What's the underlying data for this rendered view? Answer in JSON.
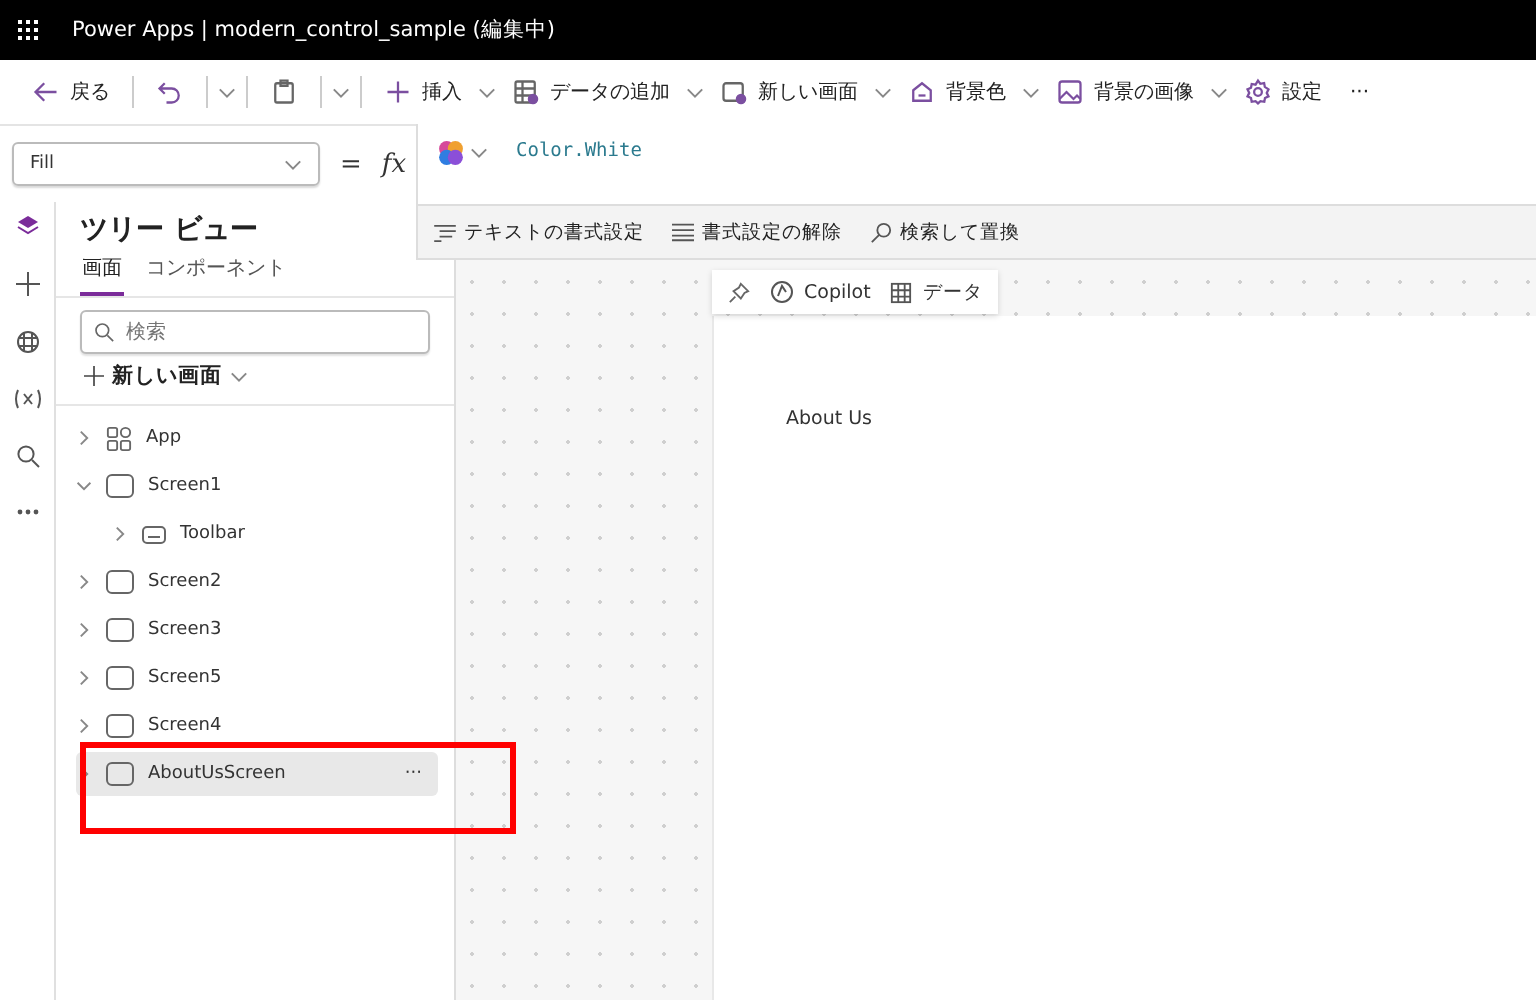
{
  "window": {
    "title": "Power Apps | modern_control_sample (編集中)"
  },
  "toolbar": [
    {
      "kind": "back",
      "label": "戻る"
    },
    {
      "kind": "undo"
    },
    {
      "kind": "paste"
    },
    {
      "kind": "insert",
      "label": "挿入"
    },
    {
      "kind": "data",
      "label": "データの追加"
    },
    {
      "kind": "screen",
      "label": "新しい画面"
    },
    {
      "kind": "bgcolor",
      "label": "背景色"
    },
    {
      "kind": "bgimage",
      "label": "背景の画像"
    },
    {
      "kind": "settings",
      "label": "設定"
    },
    {
      "kind": "more",
      "label": "···"
    }
  ],
  "formula_bar": {
    "property": "Fill",
    "equals": "=",
    "fx": "fx",
    "formula": "Color.White",
    "format_actions": [
      "テキストの書式設定",
      "書式設定の解除",
      "検索して置換"
    ]
  },
  "tree": {
    "title": "ツリー ビュー",
    "tabs": [
      {
        "label": "画面",
        "selected": true
      },
      {
        "label": "コンポーネント",
        "selected": false
      }
    ],
    "search": {
      "placeholder": "検索"
    },
    "new_screen": "新しい画面",
    "items": [
      {
        "kind": "app",
        "label": "App",
        "expanded": false,
        "selected": false
      },
      {
        "kind": "screen",
        "label": "Screen1",
        "expanded": true,
        "selected": false,
        "children": [
          {
            "kind": "component",
            "label": "Toolbar",
            "expanded": false,
            "selected": false
          }
        ]
      },
      {
        "kind": "screen",
        "label": "Screen2",
        "expanded": false,
        "selected": false
      },
      {
        "kind": "screen",
        "label": "Screen3",
        "expanded": false,
        "selected": false
      },
      {
        "kind": "screen",
        "label": "Screen5",
        "expanded": false,
        "selected": false
      },
      {
        "kind": "screen",
        "label": "Screen4",
        "expanded": false,
        "selected": false
      },
      {
        "kind": "screen",
        "label": "AboutUsScreen",
        "expanded": false,
        "selected": true,
        "more": "···"
      }
    ]
  },
  "canvas_toolbar": [
    "Copilot",
    "データ"
  ],
  "canvas": {
    "label": "About Us"
  }
}
